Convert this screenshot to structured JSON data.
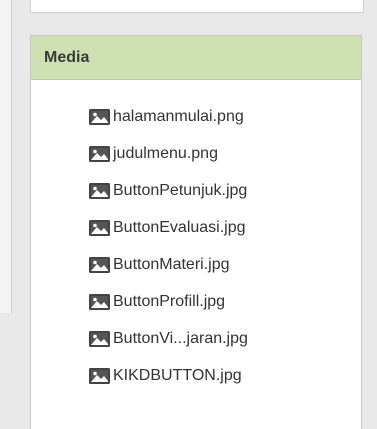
{
  "media": {
    "title": "Media",
    "items": [
      {
        "label": "halamanmulai.png",
        "icon": "image-icon"
      },
      {
        "label": "judulmenu.png",
        "icon": "image-icon"
      },
      {
        "label": "ButtonPetunjuk.jpg",
        "icon": "image-icon"
      },
      {
        "label": "ButtonEvaluasi.jpg",
        "icon": "image-icon"
      },
      {
        "label": "ButtonMateri.jpg",
        "icon": "image-icon"
      },
      {
        "label": "ButtonProfill.jpg",
        "icon": "image-icon"
      },
      {
        "label": "ButtonVi...jaran.jpg",
        "icon": "image-icon"
      },
      {
        "label": "KIKDBUTTON.jpg",
        "icon": "image-icon"
      }
    ]
  },
  "colors": {
    "header_bg": "#cfe0b3",
    "panel_bg": "#ffffff",
    "page_bg": "#e9e9e9",
    "text": "#333333"
  }
}
